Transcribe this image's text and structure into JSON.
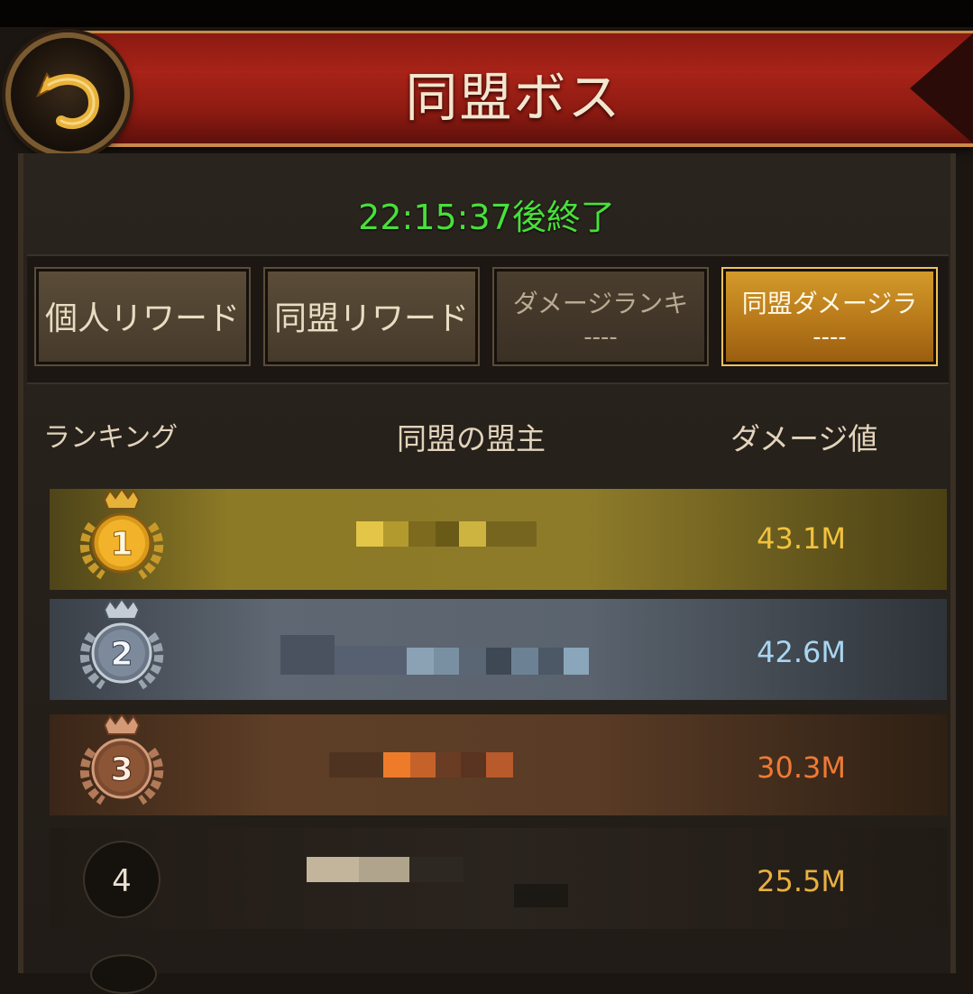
{
  "title": "同盟ボス",
  "timer": "22:15:37後終了",
  "tabs": [
    {
      "label": "個人リワード"
    },
    {
      "label": "同盟リワード"
    },
    {
      "label": "ダメージランキ",
      "sub": "----"
    },
    {
      "label": "同盟ダメージラ",
      "sub": "----",
      "active": true
    }
  ],
  "columns": {
    "rank": "ランキング",
    "leader": "同盟の盟主",
    "damage": "ダメージ値"
  },
  "rows": [
    {
      "rank": "1",
      "damage": "43.1M",
      "color": "#f2c23e",
      "tier": "gold"
    },
    {
      "rank": "2",
      "damage": "42.6M",
      "color": "#a8d6f2",
      "tier": "silver"
    },
    {
      "rank": "3",
      "damage": "30.3M",
      "color": "#f07a34",
      "tier": "bronze"
    },
    {
      "rank": "4",
      "damage": "25.5M",
      "color": "#e8b040",
      "tier": "plain"
    }
  ]
}
